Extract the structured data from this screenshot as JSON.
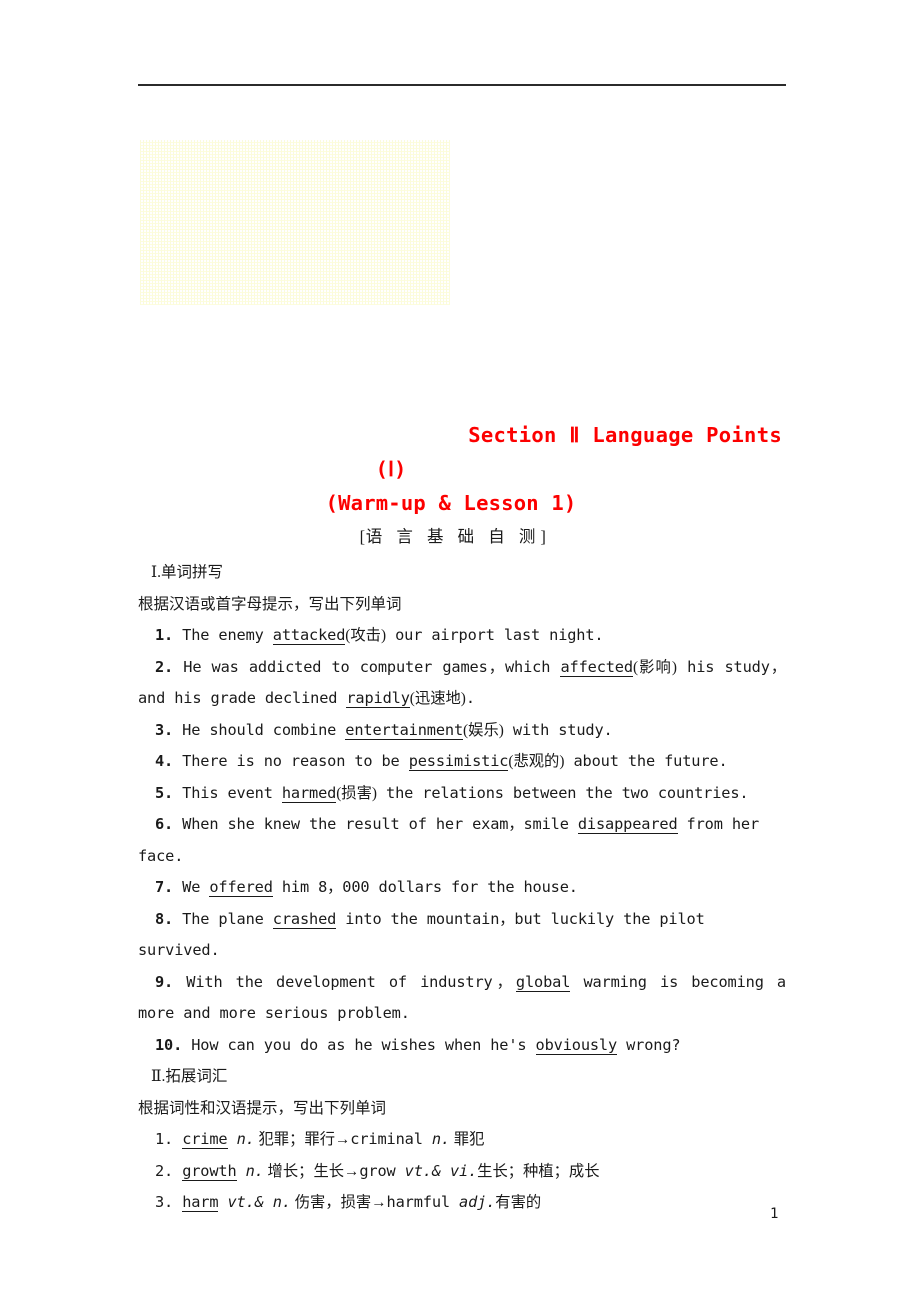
{
  "page": {
    "number": "1",
    "rule": "horizontal-rule",
    "watermark": "faint-yellow-ghost-texture",
    "text_color": "#1a1a1a",
    "heading_color": "#fc0000"
  },
  "heading": {
    "main": "Section Ⅱ  Language Points",
    "roman": "(Ⅰ)",
    "subtitle": "(Warm-up & Lesson 1)",
    "banner_open": "[",
    "banner_text": "语 言 基 础 自 测",
    "banner_close": "]"
  },
  "section_one": {
    "heading": "Ⅰ.单词拼写",
    "prompt": "根据汉语或首字母提示，写出下列单词",
    "items": [
      {
        "num": "1.",
        "pre": " The enemy ",
        "answer": "attacked",
        "gloss": "(攻击)",
        "post": " our airport last night."
      },
      {
        "num": "2.",
        "pre": " He was addicted to computer games，which ",
        "answer": "affected",
        "gloss": "(影响)",
        "post": " his study，and his grade declined ",
        "answer2": "rapidly",
        "gloss2": "(迅速地)",
        "post2": "."
      },
      {
        "num": "3.",
        "pre": " He should combine ",
        "answer": "entertainment",
        "gloss": "(娱乐)",
        "post": " with study."
      },
      {
        "num": "4.",
        "pre": " There is no reason to be ",
        "answer": "pessimistic",
        "gloss": "(悲观的)",
        "post": " about the future."
      },
      {
        "num": "5.",
        "pre": " This event ",
        "answer": "harmed",
        "gloss": "(损害)",
        "post": " the relations between the two countries."
      },
      {
        "num": "6.",
        "pre": " When she knew the result of her exam，smile ",
        "answer": "disappeared",
        "gloss": "",
        "post": " from her face."
      },
      {
        "num": "7.",
        "pre": " We ",
        "answer": "offered",
        "gloss": "",
        "post": " him 8，000 dollars for the house."
      },
      {
        "num": "8.",
        "pre": " The plane ",
        "answer": "crashed",
        "gloss": "",
        "post": " into the mountain，but luckily the pilot survived."
      },
      {
        "num": "9.",
        "pre": " With the development of industry，",
        "answer": "global",
        "gloss": "",
        "post": " warming is becoming a more and more serious problem."
      },
      {
        "num": "10.",
        "pre": " How can you do as he wishes when he's ",
        "answer": "obviously",
        "gloss": "",
        "post": " wrong?"
      }
    ]
  },
  "section_two": {
    "heading": "Ⅱ.拓展词汇",
    "prompt": "根据词性和汉语提示，写出下列单词",
    "items": [
      {
        "num": "1.",
        "word": "crime",
        "pos": "n.",
        "meaning": " 犯罪；罪行→",
        "derived": "criminal",
        "derived_pos": "n.",
        "derived_meaning": " 罪犯"
      },
      {
        "num": "2.",
        "word": "growth",
        "pos": "n.",
        "meaning": " 增长；生长→",
        "derived": "grow",
        "derived_pos": "vt.& vi.",
        "derived_meaning": "生长；种植；成长"
      },
      {
        "num": "3.",
        "word": "harm",
        "pos": "vt.& n.",
        "meaning": " 伤害，损害→",
        "derived": "harmful",
        "derived_pos": "adj.",
        "derived_meaning": "有害的"
      }
    ]
  }
}
